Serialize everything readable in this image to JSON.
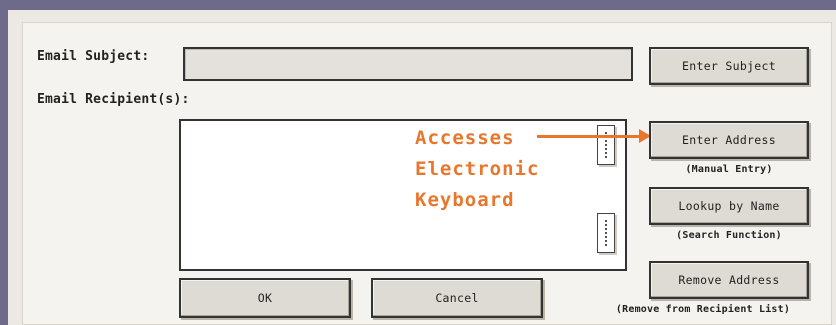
{
  "form": {
    "subject_label": "Email Subject:",
    "subject_value": "",
    "recipients_label": "Email Recipient(s):",
    "recipients": []
  },
  "buttons": {
    "enter_subject": "Enter Subject",
    "enter_address": "Enter Address",
    "lookup_by_name": "Lookup by Name",
    "remove_address": "Remove Address",
    "ok": "OK",
    "cancel": "Cancel"
  },
  "notes": {
    "enter_address": "(Manual Entry)",
    "lookup_by_name": "(Search Function)",
    "remove_address": "(Remove from Recipient List)"
  },
  "annotation": {
    "line1": "Accesses",
    "line2": "Electronic",
    "line3": "Keyboard",
    "color": "#e8772e"
  },
  "colors": {
    "frame_bg": "#6e6a8a",
    "panel_bg": "#f5f3ef",
    "button_bg": "#dedad4"
  }
}
